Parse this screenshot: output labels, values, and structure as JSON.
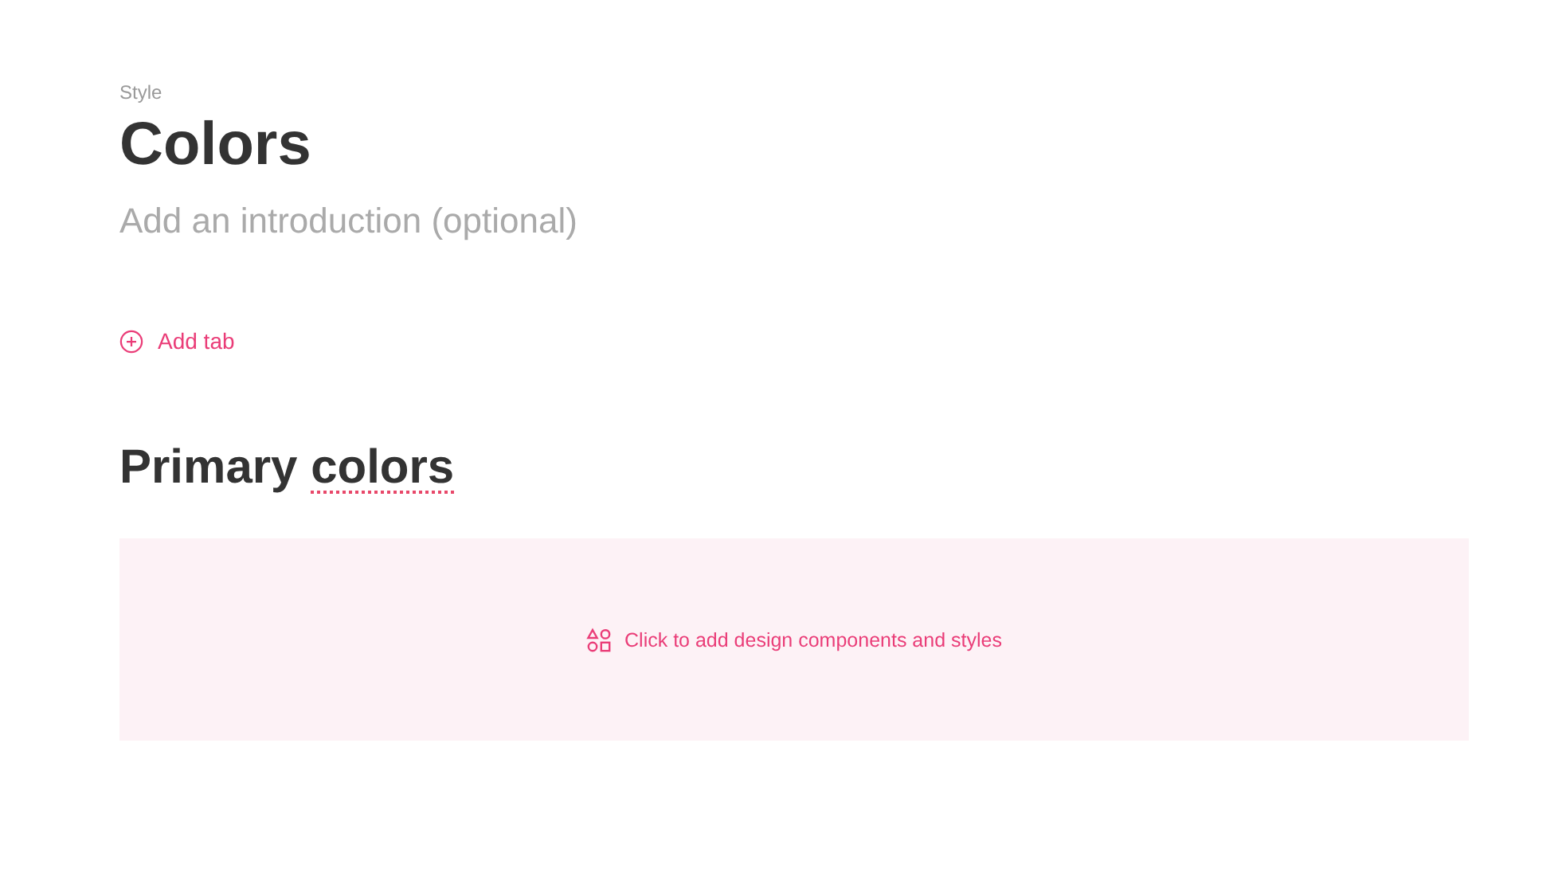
{
  "page": {
    "eyebrow": "Style",
    "title": "Colors",
    "introduction": {
      "placeholder": "Add an introduction (optional)"
    }
  },
  "add_tab": {
    "label": "Add tab"
  },
  "sections": [
    {
      "heading": [
        {
          "text": "Primary ",
          "flagged": false
        },
        {
          "text": "colors",
          "flagged": true
        }
      ],
      "dropzone": {
        "label": "Click to add design components and styles"
      }
    }
  ]
}
